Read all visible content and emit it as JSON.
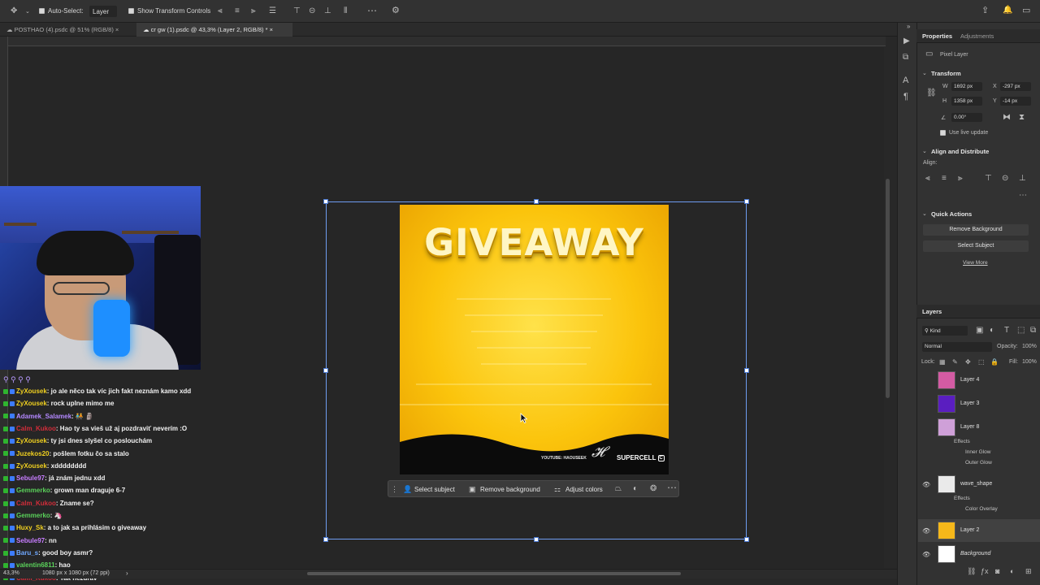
{
  "options_bar": {
    "auto_select_label": "Auto-Select:",
    "auto_select_target": "Layer",
    "show_transform_label": "Show Transform Controls"
  },
  "tabs": [
    {
      "label": "POSTHAO (4).psdc @ 51% (RGB/8)",
      "active": false
    },
    {
      "label": "cr gw (1).psdc @ 43,3% (Layer 2, RGB/8) *",
      "active": true
    }
  ],
  "artwork": {
    "title": "GIVEAWAY",
    "footer_left": "YOUTUBE: HAOUSEEK",
    "footer_right": "SUPERCELL",
    "signature": "𝓗"
  },
  "context_bar": {
    "select_subject": "Select subject",
    "remove_background": "Remove background",
    "adjust_colors": "Adjust colors"
  },
  "status": {
    "zoom": "43,3%",
    "doc_info": "1080 px x 1080 px (72 ppi)"
  },
  "chat": [
    {
      "user": "ZyXousek",
      "color": "#f0d020",
      "msg": ": jo ale něco tak víc jich fakt neznám kamo xdd"
    },
    {
      "user": "ZyXousek",
      "color": "#f0d020",
      "msg": ": rock uplne mimo me"
    },
    {
      "user": "Adamek_Salamek",
      "color": "#b388ff",
      "msg": ": 🧑‍🤝‍🧑 🗿"
    },
    {
      "user": "Calm_Kukoo",
      "color": "#d22d3a",
      "msg": ": Hao ty sa vieš už aj pozdraviť neverím :O"
    },
    {
      "user": "ZyXousek",
      "color": "#f0d020",
      "msg": ": ty jsi dnes slyšel co poslouchám"
    },
    {
      "user": "Juzekos20",
      "color": "#f0d020",
      "msg": ": pošlem fotku čo sa stalo"
    },
    {
      "user": "ZyXousek",
      "color": "#f0d020",
      "msg": ": xdddddddd"
    },
    {
      "user": "Sebule97",
      "color": "#c77dff",
      "msg": ": já znám jednu xdd"
    },
    {
      "user": "Gemmerko",
      "color": "#5ad15a",
      "msg": ": grown man draguje 6-7"
    },
    {
      "user": "Calm_Kukoo",
      "color": "#d22d3a",
      "msg": ": Zname se?"
    },
    {
      "user": "Gemmerko",
      "color": "#5ad15a",
      "msg": ": 🦄"
    },
    {
      "user": "Huxy_Sk",
      "color": "#f0d020",
      "msg": ": a to jak sa prihlásim o giveaway"
    },
    {
      "user": "Sebule97",
      "color": "#c77dff",
      "msg": ": nn"
    },
    {
      "user": "Baru_s",
      "color": "#6fa8ff",
      "msg": ": good boy asmr?"
    },
    {
      "user": "valentin6811",
      "color": "#5ad15a",
      "msg": ": hao"
    },
    {
      "user": "Calm_Kukoo",
      "color": "#d22d3a",
      "msg": ": Tak nezdrav"
    }
  ],
  "properties": {
    "tab_properties": "Properties",
    "tab_adjustments": "Adjustments",
    "kind_label": "Pixel Layer",
    "transform_header": "Transform",
    "w_label": "W",
    "w_value": "1692 px",
    "h_label": "H",
    "h_value": "1358 px",
    "x_label": "X",
    "x_value": "-297 px",
    "y_label": "Y",
    "y_value": "-14 px",
    "angle_value": "0.00°",
    "live_update": "Use live update",
    "align_header": "Align and Distribute",
    "align_label": "Align:",
    "quick_header": "Quick Actions",
    "remove_bg_button": "Remove Background",
    "select_subject_button": "Select Subject",
    "view_more": "View More"
  },
  "layers_panel": {
    "title": "Layers",
    "filter_kind": "Kind",
    "blend_mode": "Normal",
    "opacity_label": "Opacity:",
    "opacity_value": "100%",
    "lock_label": "Lock:",
    "fill_label": "Fill:",
    "fill_value": "100%",
    "effects_label": "Effects",
    "layers": [
      {
        "name": "Layer 4",
        "visible": false,
        "thumb": "#d35ba3"
      },
      {
        "name": "Layer 3",
        "visible": false,
        "thumb": "#5a1ec0"
      },
      {
        "name": "Layer 8",
        "visible": false,
        "thumb": "#cfa0d8",
        "effects": [
          "Inner Glow",
          "Outer Glow"
        ]
      },
      {
        "name": "wave_shape",
        "visible": true,
        "thumb": "#eaeaea",
        "effects": [
          "Color Overlay"
        ]
      },
      {
        "name": "Layer 2",
        "visible": true,
        "thumb": "#f6b81a",
        "selected": true
      },
      {
        "name": "Background",
        "visible": true,
        "thumb": "#ffffff"
      }
    ]
  }
}
